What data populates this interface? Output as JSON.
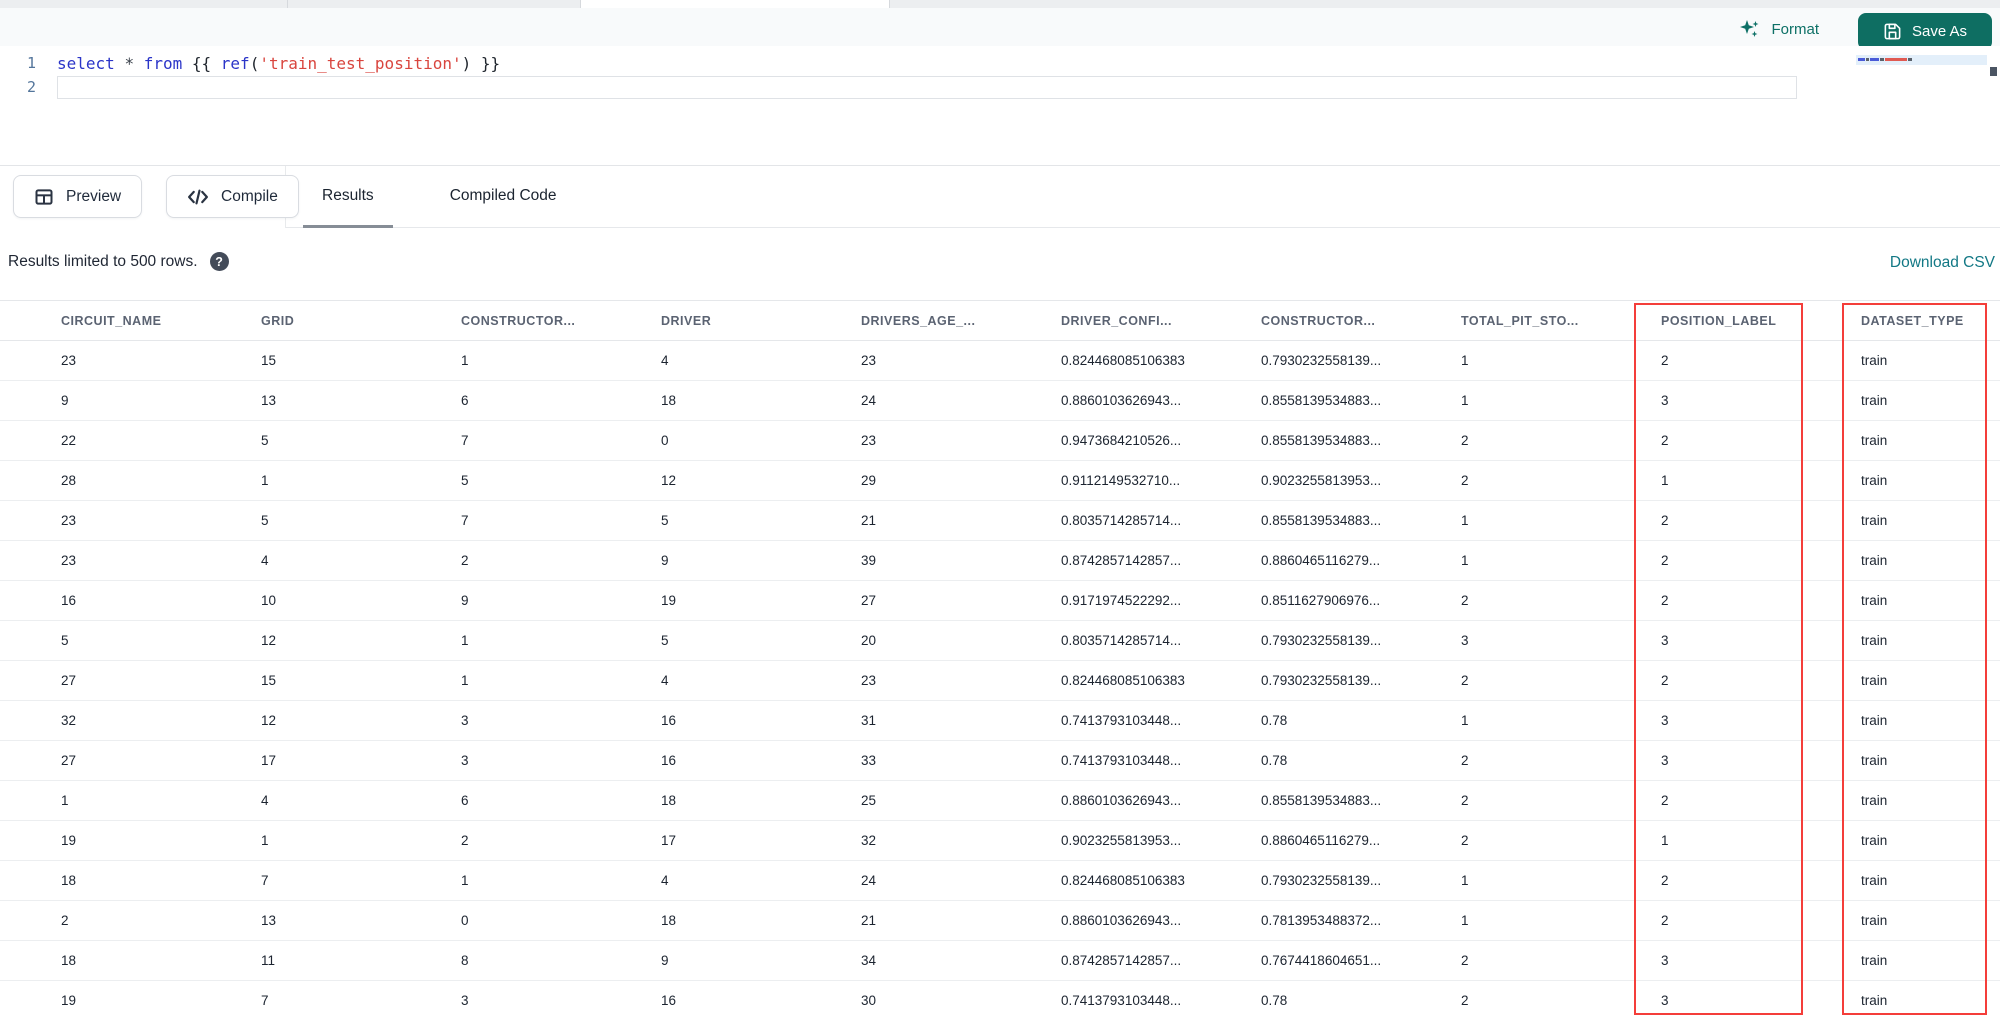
{
  "toolbar": {
    "format_label": "Format",
    "save_as_label": "Save As"
  },
  "editor": {
    "line_numbers": [
      "1",
      "2"
    ],
    "code_line": {
      "tokens": [
        {
          "text": "select",
          "type": "keyword"
        },
        {
          "text": " ",
          "type": "plain"
        },
        {
          "text": "*",
          "type": "operator"
        },
        {
          "text": " ",
          "type": "plain"
        },
        {
          "text": "from",
          "type": "keyword"
        },
        {
          "text": " {{ ",
          "type": "plain"
        },
        {
          "text": "ref",
          "type": "keyword"
        },
        {
          "text": "(",
          "type": "plain"
        },
        {
          "text": "'train_test_position'",
          "type": "string"
        },
        {
          "text": ") }}",
          "type": "plain"
        }
      ]
    }
  },
  "panel": {
    "preview_label": "Preview",
    "compile_label": "Compile",
    "tabs": [
      {
        "label": "Results",
        "active": true
      },
      {
        "label": "Compiled Code",
        "active": false
      }
    ]
  },
  "results_bar": {
    "limit_text": "Results limited to 500 rows.",
    "help_icon": "?",
    "download_label": "Download CSV"
  },
  "table": {
    "columns": [
      "CIRCUIT_NAME",
      "GRID",
      "CONSTRUCTOR...",
      "DRIVER",
      "DRIVERS_AGE_...",
      "DRIVER_CONFI...",
      "CONSTRUCTOR...",
      "TOTAL_PIT_STO...",
      "POSITION_LABEL",
      "DATASET_TYPE"
    ],
    "rows": [
      [
        "23",
        "15",
        "1",
        "4",
        "23",
        "0.824468085106383",
        "0.7930232558139...",
        "1",
        "2",
        "train"
      ],
      [
        "9",
        "13",
        "6",
        "18",
        "24",
        "0.8860103626943...",
        "0.8558139534883...",
        "1",
        "3",
        "train"
      ],
      [
        "22",
        "5",
        "7",
        "0",
        "23",
        "0.9473684210526...",
        "0.8558139534883...",
        "2",
        "2",
        "train"
      ],
      [
        "28",
        "1",
        "5",
        "12",
        "29",
        "0.9112149532710...",
        "0.9023255813953...",
        "2",
        "1",
        "train"
      ],
      [
        "23",
        "5",
        "7",
        "5",
        "21",
        "0.8035714285714...",
        "0.8558139534883...",
        "1",
        "2",
        "train"
      ],
      [
        "23",
        "4",
        "2",
        "9",
        "39",
        "0.8742857142857...",
        "0.8860465116279...",
        "1",
        "2",
        "train"
      ],
      [
        "16",
        "10",
        "9",
        "19",
        "27",
        "0.9171974522292...",
        "0.8511627906976...",
        "2",
        "2",
        "train"
      ],
      [
        "5",
        "12",
        "1",
        "5",
        "20",
        "0.8035714285714...",
        "0.7930232558139...",
        "3",
        "3",
        "train"
      ],
      [
        "27",
        "15",
        "1",
        "4",
        "23",
        "0.824468085106383",
        "0.7930232558139...",
        "2",
        "2",
        "train"
      ],
      [
        "32",
        "12",
        "3",
        "16",
        "31",
        "0.7413793103448...",
        "0.78",
        "1",
        "3",
        "train"
      ],
      [
        "27",
        "17",
        "3",
        "16",
        "33",
        "0.7413793103448...",
        "0.78",
        "2",
        "3",
        "train"
      ],
      [
        "1",
        "4",
        "6",
        "18",
        "25",
        "0.8860103626943...",
        "0.8558139534883...",
        "2",
        "2",
        "train"
      ],
      [
        "19",
        "1",
        "2",
        "17",
        "32",
        "0.9023255813953...",
        "0.8860465116279...",
        "2",
        "1",
        "train"
      ],
      [
        "18",
        "7",
        "1",
        "4",
        "24",
        "0.824468085106383",
        "0.7930232558139...",
        "1",
        "2",
        "train"
      ],
      [
        "2",
        "13",
        "0",
        "18",
        "21",
        "0.8860103626943...",
        "0.7813953488372...",
        "1",
        "2",
        "train"
      ],
      [
        "18",
        "11",
        "8",
        "9",
        "34",
        "0.8742857142857...",
        "0.7674418604651...",
        "2",
        "3",
        "train"
      ],
      [
        "19",
        "7",
        "3",
        "16",
        "30",
        "0.7413793103448...",
        "0.78",
        "2",
        "3",
        "train"
      ]
    ]
  },
  "annotations": {
    "highlight_color": "#f43e3a",
    "highlighted_columns": [
      "POSITION_LABEL",
      "DATASET_TYPE"
    ]
  },
  "colors": {
    "accent_teal": "#0e6e62",
    "link_teal": "#127885",
    "keyword_blue": "#2b35c8",
    "string_red": "#d9453e"
  }
}
